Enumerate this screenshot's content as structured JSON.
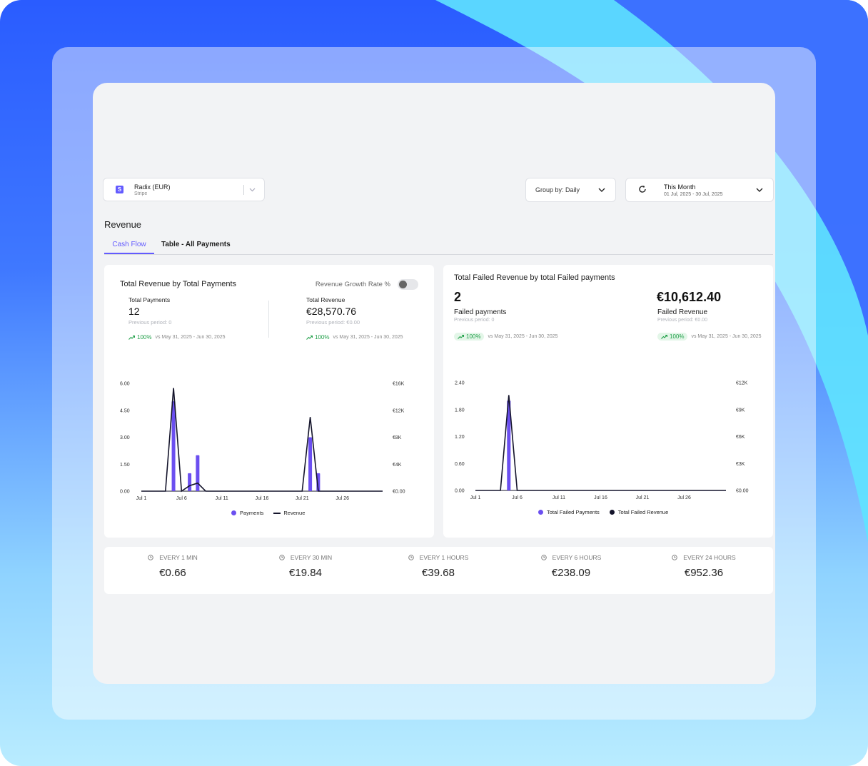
{
  "account": {
    "badge": "S",
    "name": "Radix (EUR)",
    "provider": "Stripe"
  },
  "group_by": "Group by: Daily",
  "date_range": {
    "label": "This Month",
    "range": "01 Jul, 2025 - 30 Jul, 2025"
  },
  "page_title": "Revenue",
  "tabs": [
    {
      "label": "Cash Flow",
      "active": true
    },
    {
      "label": "Table - All Payments",
      "active": false
    }
  ],
  "left_card": {
    "title": "Total Revenue by Total Payments",
    "toggle_label": "Revenue Growth Rate %",
    "toggle_on": false,
    "payments": {
      "label": "Total Payments",
      "value": "12",
      "previous": "Previous period: 0",
      "change": "100%",
      "compare": "vs May 31, 2025 - Jun 30, 2025"
    },
    "revenue": {
      "label": "Total Revenue",
      "value": "€28,570.76",
      "previous": "Previous period: €0.00",
      "change": "100%",
      "compare": "vs May 31, 2025 - Jun 30, 2025"
    },
    "legend": {
      "bars": "Payments",
      "line": "Revenue"
    }
  },
  "right_card": {
    "title": "Total Failed Revenue by total Failed payments",
    "failed_payments": {
      "value": "2",
      "label": "Failed payments",
      "previous": "Previous period: 0",
      "change": "100%",
      "compare": "vs May 31, 2025 - Jun 30, 2025"
    },
    "failed_revenue": {
      "value": "€10,612.40",
      "label": "Failed Revenue",
      "previous": "Previous period: €0.00",
      "change": "100%",
      "compare": "vs May 31, 2025 - Jun 30, 2025"
    },
    "legend": {
      "bars": "Total Failed Payments",
      "line": "Total Failed Revenue"
    }
  },
  "frequencies": [
    {
      "label": "EVERY 1 MIN",
      "value": "€0.66"
    },
    {
      "label": "EVERY 30 MIN",
      "value": "€19.84"
    },
    {
      "label": "EVERY 1 HOURS",
      "value": "€39.68"
    },
    {
      "label": "EVERY 6 HOURS",
      "value": "€238.09"
    },
    {
      "label": "EVERY 24 HOURS",
      "value": "€952.36"
    }
  ],
  "colors": {
    "accent": "#635bff",
    "bar": "#6b4ff0",
    "line": "#14142b",
    "positive": "#22a04a"
  },
  "chart_data": [
    {
      "type": "bar",
      "title": "Total Revenue by Total Payments",
      "x_ticks": [
        "Jul 1",
        "Jul 6",
        "Jul 11",
        "Jul 16",
        "Jul 21",
        "Jul 26"
      ],
      "y_ticks": [
        "0.00",
        "1.50",
        "3.00",
        "4.50",
        "6.00"
      ],
      "y2_ticks": [
        "€0.00",
        "€4K",
        "€8K",
        "€12K",
        "€16K"
      ],
      "ylim": [
        0,
        6
      ],
      "y2lim": [
        0,
        16000
      ],
      "day_range": [
        1,
        31
      ],
      "series": [
        {
          "name": "Payments",
          "kind": "bar",
          "axis": "left",
          "points": [
            [
              5,
              5
            ],
            [
              7,
              1
            ],
            [
              8,
              2
            ],
            [
              22,
              3
            ],
            [
              23,
              1
            ]
          ]
        },
        {
          "name": "Revenue",
          "kind": "line",
          "axis": "right",
          "points": [
            [
              1,
              0
            ],
            [
              4,
              0
            ],
            [
              5,
              15300
            ],
            [
              6,
              0
            ],
            [
              7,
              800
            ],
            [
              8,
              1200
            ],
            [
              9,
              0
            ],
            [
              21,
              0
            ],
            [
              22,
              11000
            ],
            [
              23,
              0
            ],
            [
              31,
              0
            ]
          ]
        }
      ],
      "legend": "bottom"
    },
    {
      "type": "bar",
      "title": "Total Failed Revenue by total Failed payments",
      "x_ticks": [
        "Jul 1",
        "Jul 6",
        "Jul 11",
        "Jul 16",
        "Jul 21",
        "Jul 26"
      ],
      "y_ticks": [
        "0.00",
        "0.60",
        "1.20",
        "1.80",
        "2.40"
      ],
      "y2_ticks": [
        "€0.00",
        "€3K",
        "€6K",
        "€9K",
        "€12K"
      ],
      "ylim": [
        0,
        2.4
      ],
      "y2lim": [
        0,
        12000
      ],
      "day_range": [
        1,
        31
      ],
      "series": [
        {
          "name": "Total Failed Payments",
          "kind": "bar",
          "axis": "left",
          "points": [
            [
              5,
              2
            ]
          ]
        },
        {
          "name": "Total Failed Revenue",
          "kind": "line",
          "axis": "right",
          "points": [
            [
              1,
              0
            ],
            [
              4,
              0
            ],
            [
              5,
              10612.4
            ],
            [
              6,
              0
            ],
            [
              31,
              0
            ]
          ]
        }
      ],
      "legend": "bottom"
    }
  ]
}
